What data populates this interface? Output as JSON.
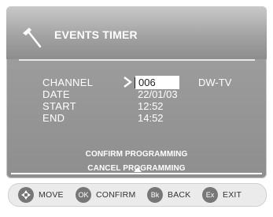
{
  "header": {
    "title": "EVENTS TIMER",
    "icon": "hammer-icon"
  },
  "fields": {
    "channel": {
      "label": "CHANNEL",
      "value": "006",
      "name": "DW-TV"
    },
    "date": {
      "label": "DATE",
      "value": "22/01/03"
    },
    "start": {
      "label": "START",
      "value": "12:52"
    },
    "end": {
      "label": "END",
      "value": "14:52"
    }
  },
  "actions": {
    "confirm": "CONFIRM PROGRAMMING",
    "cancel": "CANCEL PROGRAMMING"
  },
  "footer": {
    "move": {
      "badge_icon": "dpad-icon",
      "label": "MOVE"
    },
    "confirm": {
      "badge": "OK",
      "label": "CONFIRM"
    },
    "back": {
      "badge": "Bk",
      "label": "BACK"
    },
    "exit": {
      "badge": "Ex",
      "label": "EXIT"
    }
  },
  "colors": {
    "panel": "#9a9a9a",
    "text": "#ffffff",
    "badge": "#777777",
    "footer_bg": "#ebebeb"
  }
}
